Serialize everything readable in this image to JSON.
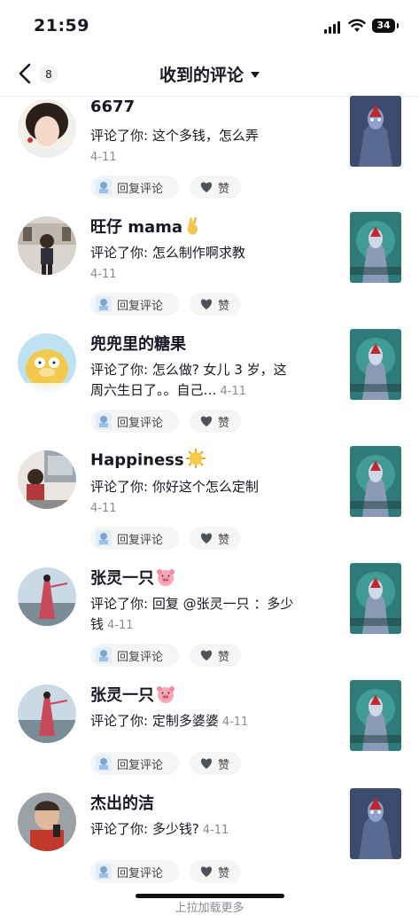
{
  "status": {
    "time": "21:59",
    "battery": "34"
  },
  "header": {
    "back_count": "8",
    "title": "收到的评论"
  },
  "actions": {
    "reply_label": "回复评论",
    "like_label": "赞"
  },
  "comments": [
    {
      "name": "6677",
      "emoji": "",
      "text": "评论了你: 这个多钱，怎么弄",
      "date": "4-11",
      "date_inline": false
    },
    {
      "name": "旺仔 mama",
      "emoji": "fingers-crossed-emoji",
      "text": "评论了你: 怎么制作啊求教",
      "date": "4-11",
      "date_inline": false
    },
    {
      "name": "兜兜里的糖果",
      "emoji": "",
      "text": "评论了你: 怎么做? 女儿 3 岁，这周六生日了。。自己…",
      "date": "4-11",
      "date_inline": true
    },
    {
      "name": "Happiness",
      "emoji": "sun-emoji",
      "text": "评论了你: 你好这个怎么定制",
      "date": "4-11",
      "date_inline": false
    },
    {
      "name": "张灵一只",
      "emoji": "pig-emoji",
      "text": "评论了你: 回复 @张灵一只 ：多少钱",
      "date": "4-11",
      "date_inline": true
    },
    {
      "name": "张灵一只",
      "emoji": "pig-emoji",
      "text": "评论了你: 定制多婆婆",
      "date": "4-11",
      "date_inline": true
    },
    {
      "name": "杰出的洁",
      "emoji": "",
      "text": "评论了你: 多少钱?",
      "date": "4-11",
      "date_inline": true
    }
  ],
  "footer": {
    "load_more": "上拉加载更多"
  },
  "colors": {
    "text": "#161823",
    "secondary": "#8a8b91",
    "button_bg": "#f5f5f6"
  }
}
